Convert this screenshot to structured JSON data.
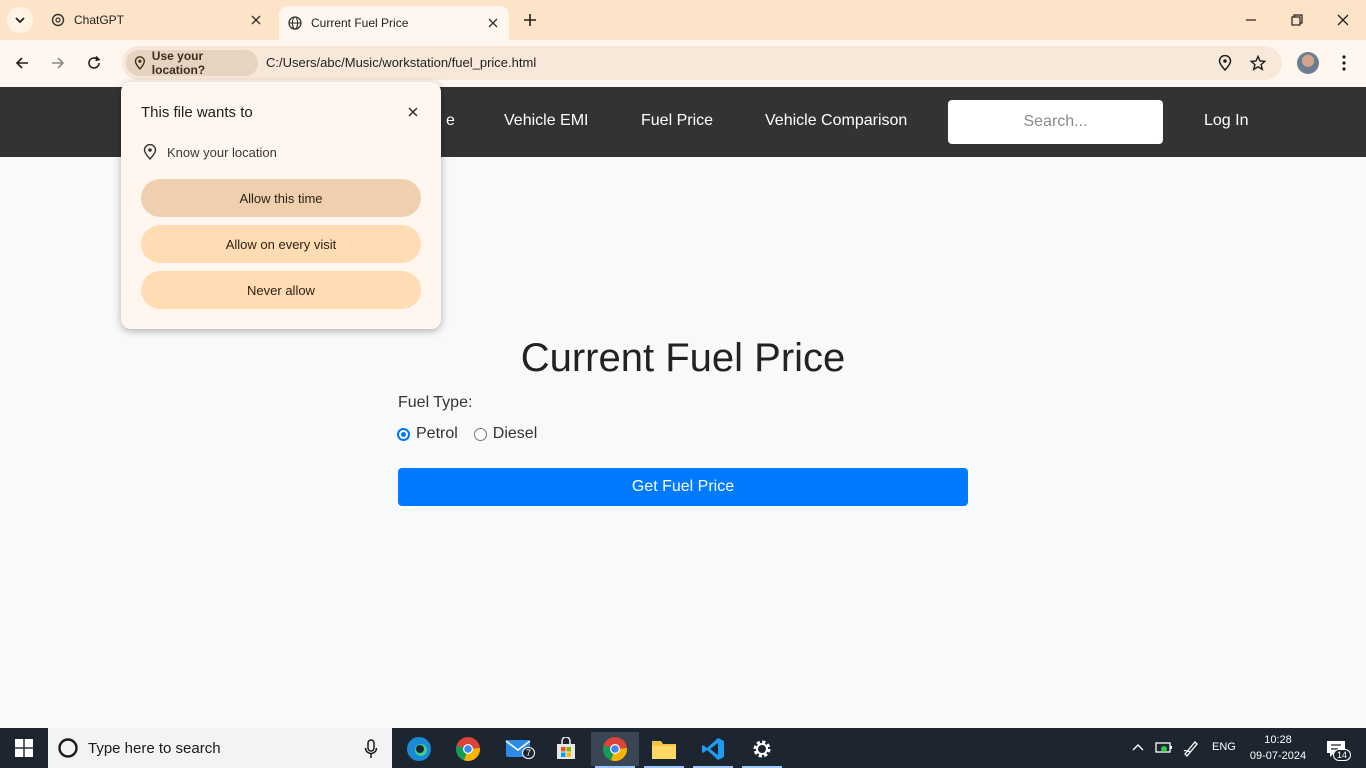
{
  "browser": {
    "tabs": [
      {
        "title": "ChatGPT",
        "icon": "chatgpt-icon",
        "active": false
      },
      {
        "title": "Current Fuel Price",
        "icon": "globe-icon",
        "active": true
      }
    ],
    "location_chip": "Use your location?",
    "url": "C:/Users/abc/Music/workstation/fuel_price.html"
  },
  "site_nav": {
    "links": [
      "Vehicle EMI",
      "Fuel Price",
      "Vehicle Comparison"
    ],
    "partial_link": "e",
    "search_placeholder": "Search...",
    "login": "Log In"
  },
  "main": {
    "title": "Current Fuel Price",
    "fuel_type_label": "Fuel Type:",
    "options": [
      {
        "label": "Petrol",
        "checked": true
      },
      {
        "label": "Diesel",
        "checked": false
      }
    ],
    "button": "Get Fuel Price",
    "button_color": "#007bff"
  },
  "permission_popup": {
    "title": "This file wants to",
    "permission": "Know your location",
    "buttons": [
      "Allow this time",
      "Allow on every visit",
      "Never allow"
    ]
  },
  "taskbar": {
    "search_placeholder": "Type here to search",
    "mail_badge": "7",
    "language": "ENG",
    "time": "10:28",
    "date": "09-07-2024",
    "notification_count": "14"
  }
}
